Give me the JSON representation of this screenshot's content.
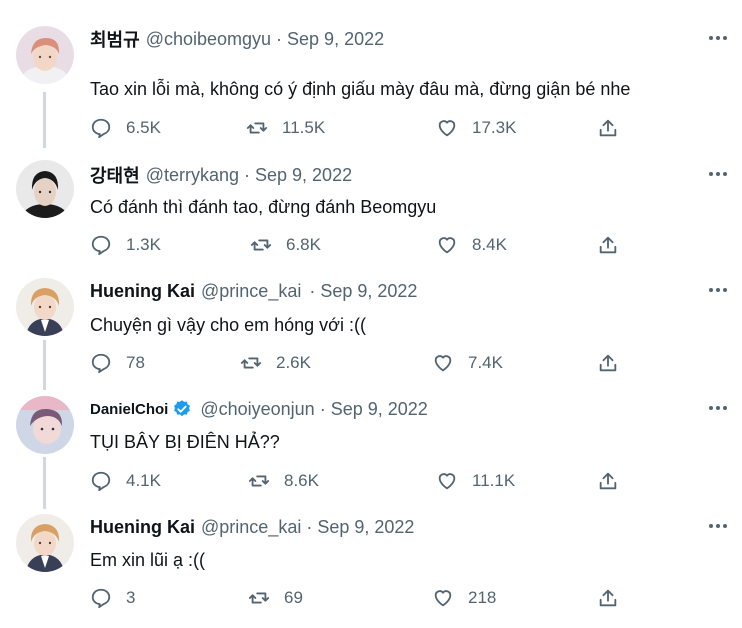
{
  "tweets": [
    {
      "name": "최범규",
      "handle": "@choibeomgyu",
      "date": "Sep 9, 2022",
      "verified": false,
      "text": "Tao xin lỗi mà, không có ý định giấu mày đâu mà, đừng giận bé nhe",
      "replies": "6.5K",
      "retweets": "11.5K",
      "likes": "17.3K"
    },
    {
      "name": "강태현",
      "handle": "@terrykang",
      "date": "Sep 9, 2022",
      "verified": false,
      "text": "Có đánh thì đánh tao, đừng đánh Beomgyu",
      "replies": "1.3K",
      "retweets": "6.8K",
      "likes": "8.4K"
    },
    {
      "name": "Huening Kai",
      "handle": "@prince_kai",
      "date": "Sep 9, 2022",
      "verified": false,
      "text": "Chuyện gì vậy cho em hóng với :((",
      "replies": "78",
      "retweets": "2.6K",
      "likes": "7.4K"
    },
    {
      "name": "DanielChoi",
      "handle": "@choiyeonjun",
      "date": "Sep 9, 2022",
      "verified": true,
      "text": "TỤI BÂY BỊ ĐIÊN HẢ??",
      "replies": "4.1K",
      "retweets": "8.6K",
      "likes": "11.1K"
    },
    {
      "name": "Huening Kai",
      "handle": "@prince_kai",
      "date": "Sep 9, 2022",
      "verified": false,
      "text": "Em xin lũi ạ :((",
      "replies": "3",
      "retweets": "69",
      "likes": "218"
    }
  ],
  "icons": {
    "reply": "reply-icon",
    "retweet": "retweet-icon",
    "like": "heart-icon",
    "share": "share-icon",
    "more": "more-icon",
    "verified": "verified-badge-icon"
  },
  "colors": {
    "text": "#0f1419",
    "secondary": "#536471",
    "thread_line": "#cfd9de",
    "verified": "#1d9bf0"
  }
}
